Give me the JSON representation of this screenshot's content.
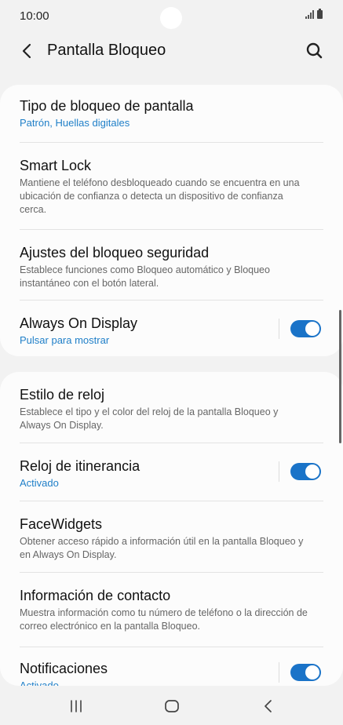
{
  "status_bar": {
    "time": "10:00"
  },
  "header": {
    "title": "Pantalla Bloqueo"
  },
  "card1": [
    {
      "title": "Tipo de bloqueo de pantalla",
      "subtitle": "Patrón, Huellas digitales"
    },
    {
      "title": "Smart Lock",
      "description": "Mantiene el teléfono desbloqueado cuando se encuentra en una ubicación de confianza o detecta un dispositivo de confianza cerca."
    },
    {
      "title": "Ajustes del bloqueo seguridad",
      "description": "Establece funciones como Bloqueo automático y Bloqueo instantáneo con el botón lateral."
    },
    {
      "title": "Always On Display",
      "subtitle": "Pulsar para mostrar",
      "toggle": true
    }
  ],
  "card2": [
    {
      "title": "Estilo de reloj",
      "description": "Establece el tipo y el color del reloj de la pantalla Bloqueo y Always On Display."
    },
    {
      "title": "Reloj de itinerancia",
      "subtitle": "Activado",
      "toggle": true
    },
    {
      "title": "FaceWidgets",
      "description": "Obtener acceso rápido a información útil en la pantalla Bloqueo y en Always On Display."
    },
    {
      "title": "Información de contacto",
      "description": "Muestra información como tu número de teléfono o la dirección de correo electrónico en la pantalla Bloqueo."
    },
    {
      "title": "Notificaciones",
      "subtitle": "Activado",
      "toggle": true
    }
  ],
  "colors": {
    "accent": "#1a73c8",
    "link": "#1f7fc8",
    "background": "#f2f2f2",
    "card": "#fcfcfc"
  },
  "icons": {
    "back": "chevron-left-icon",
    "search": "search-icon",
    "recents": "recents-icon",
    "home": "home-icon",
    "nav_back": "nav-back-icon"
  }
}
